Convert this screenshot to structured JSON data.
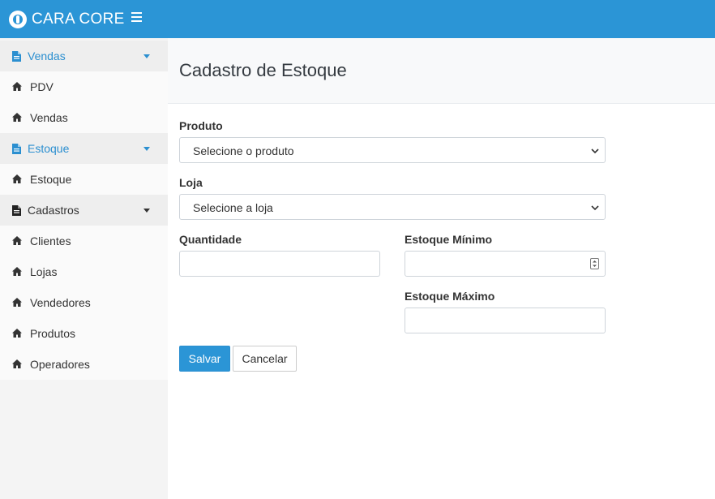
{
  "app": {
    "logo_text": "CARA CORE"
  },
  "sidebar": {
    "items": [
      {
        "label": "Vendas",
        "type": "group"
      },
      {
        "label": "PDV",
        "type": "sub"
      },
      {
        "label": "Vendas",
        "type": "sub"
      },
      {
        "label": "Estoque",
        "type": "group"
      },
      {
        "label": "Estoque",
        "type": "sub"
      },
      {
        "label": "Cadastros",
        "type": "group"
      },
      {
        "label": "Clientes",
        "type": "sub"
      },
      {
        "label": "Lojas",
        "type": "sub"
      },
      {
        "label": "Vendedores",
        "type": "sub"
      },
      {
        "label": "Produtos",
        "type": "sub"
      },
      {
        "label": "Operadores",
        "type": "sub"
      }
    ]
  },
  "page": {
    "title": "Cadastro de Estoque"
  },
  "form": {
    "produto": {
      "label": "Produto",
      "value": "Selecione o produto"
    },
    "loja": {
      "label": "Loja",
      "value": "Selecione a loja"
    },
    "quantidade": {
      "label": "Quantidade",
      "value": ""
    },
    "estoque_minimo": {
      "label": "Estoque Mínimo",
      "value": ""
    },
    "estoque_maximo": {
      "label": "Estoque Máximo",
      "value": ""
    },
    "save_label": "Salvar",
    "cancel_label": "Cancelar"
  },
  "colors": {
    "accent": "#2b95d6",
    "sidebar_bg": "#f4f4f4",
    "header_bg": "#f8f9fa"
  }
}
